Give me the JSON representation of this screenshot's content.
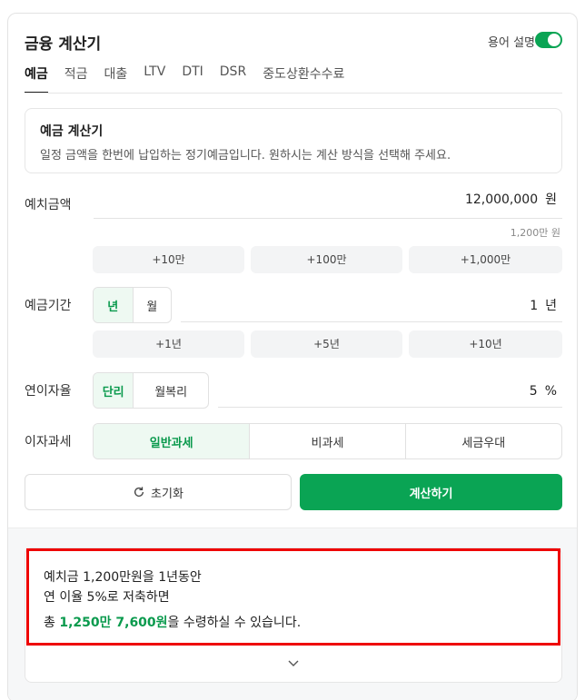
{
  "header": {
    "title": "금융 계산기",
    "glossary_label": "용어 설명",
    "glossary_toggle_on": true
  },
  "tabs": [
    {
      "label": "예금",
      "active": true
    },
    {
      "label": "적금"
    },
    {
      "label": "대출"
    },
    {
      "label": "LTV"
    },
    {
      "label": "DTI"
    },
    {
      "label": "DSR"
    },
    {
      "label": "중도상환수수료"
    }
  ],
  "info": {
    "title": "예금 계산기",
    "description": "일정 금액을 한번에 납입하는 정기예금입니다. 원하시는 계산 방식을 선택해 주세요."
  },
  "deposit": {
    "label": "예치금액",
    "value": "12,000,000",
    "unit": "원",
    "hint": "1,200만 원",
    "quick": [
      "+10만",
      "+100만",
      "+1,000만"
    ]
  },
  "period": {
    "label": "예금기간",
    "units": [
      "년",
      "월"
    ],
    "value": "1",
    "unit": "년",
    "quick": [
      "+1년",
      "+5년",
      "+10년"
    ]
  },
  "rate": {
    "label": "연이자율",
    "types": [
      "단리",
      "월복리"
    ],
    "value": "5",
    "unit": "%"
  },
  "tax": {
    "label": "이자과세",
    "options": [
      "일반과세",
      "비과세",
      "세금우대"
    ]
  },
  "actions": {
    "reset": "초기화",
    "calculate": "계산하기"
  },
  "result": {
    "line1": "예치금 1,200만원을 1년동안",
    "line2": "연 이율 5%로 저축하면",
    "prefix": "총 ",
    "amount": "1,250만 7,600원",
    "suffix": "을 수령하실 수 있습니다."
  },
  "colors": {
    "accent": "#0aa454",
    "highlight_border": "#ee0000"
  }
}
